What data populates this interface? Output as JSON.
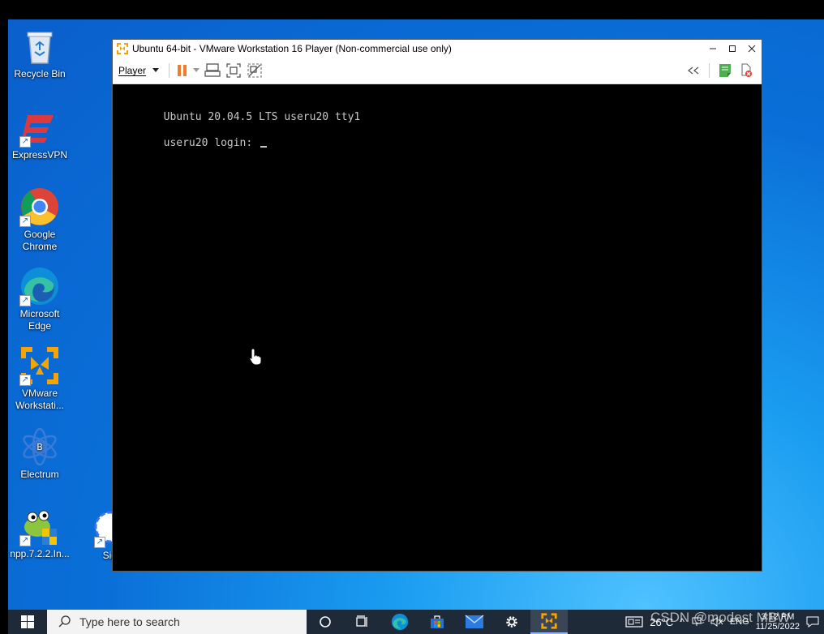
{
  "desktop": {
    "icons": [
      {
        "label": "Recycle Bin"
      },
      {
        "label": "ExpressVPN"
      },
      {
        "label": "Google Chrome"
      },
      {
        "label": "Microsoft Edge"
      },
      {
        "label": "VMware Workstati..."
      },
      {
        "label": "Electrum"
      },
      {
        "label": "npp.7.2.2.In..."
      },
      {
        "label": "Signa"
      }
    ]
  },
  "vmware": {
    "title": "Ubuntu 64-bit - VMware Workstation 16 Player (Non-commercial use only)",
    "player_menu": "Player",
    "accent": "#f5a400",
    "console": {
      "line1": "Ubuntu 20.04.5 LTS useru20 tty1",
      "line2": "useru20 login: "
    }
  },
  "taskbar": {
    "search_placeholder": "Type here to search",
    "temperature": "26°C",
    "language": "ENG",
    "time": "3:12 PM",
    "date": "11/25/2022"
  },
  "watermark": "CSDN @modest MBW"
}
